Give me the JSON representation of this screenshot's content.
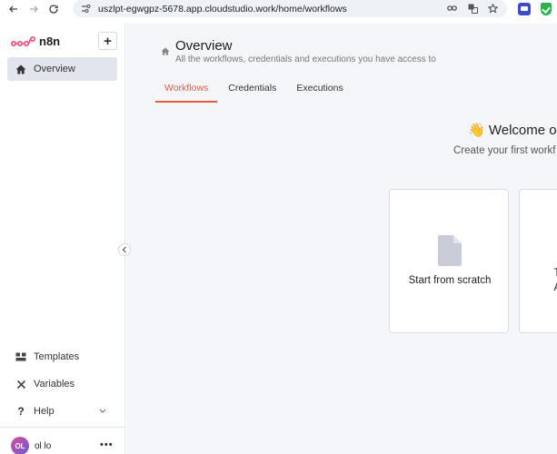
{
  "browser": {
    "url": "uszlpt-egwgpz-5678.app.cloudstudio.work/home/workflows"
  },
  "sidebar": {
    "brand": "n8n",
    "items": [
      {
        "label": "Overview",
        "icon": "home-icon",
        "active": true
      },
      {
        "label": "Templates",
        "icon": "templates-icon"
      },
      {
        "label": "Variables",
        "icon": "variables-icon"
      },
      {
        "label": "Help",
        "icon": "help-icon"
      }
    ],
    "user": {
      "initials": "OL",
      "name": "ol lo"
    }
  },
  "main": {
    "title": "Overview",
    "subtitle": "All the workflows, credentials and executions you have access to",
    "tabs": [
      {
        "label": "Workflows",
        "active": true
      },
      {
        "label": "Credentials"
      },
      {
        "label": "Executions"
      }
    ],
    "welcome": "👋 Welcome ol!",
    "create_first": "Create your first workf",
    "cards": [
      {
        "label": "Start from scratch",
        "icon": "document-icon"
      },
      {
        "label_line1": "Test",
        "label_line2": "AI A"
      }
    ]
  },
  "colors": {
    "accent": "#e55b40",
    "brand": "#ea4b71",
    "sidebar_active_bg": "#e2e5ec",
    "main_bg": "#f5f6f9"
  }
}
